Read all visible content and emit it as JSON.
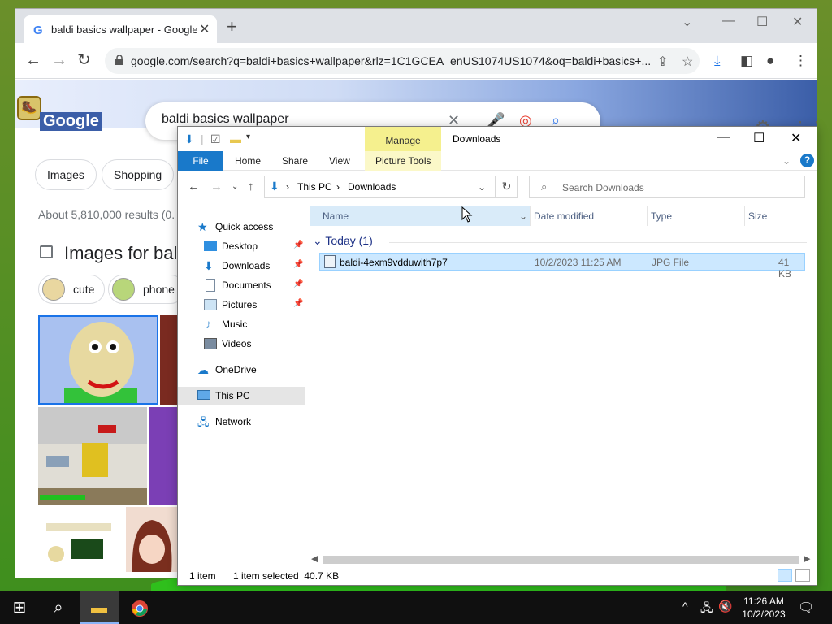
{
  "chrome": {
    "tab_title": "baldi basics wallpaper - Google Search",
    "tab_close": "✕",
    "new_tab": "+",
    "url": "google.com/search?q=baldi+basics+wallpaper&rlz=1C1GCEA_enUS1074US1074&oq=baldi+basics+..."
  },
  "google": {
    "logo": "Google",
    "search_query": "baldi basics wallpaper",
    "chips": [
      "Images",
      "Shopping"
    ],
    "results_count": "About 5,810,000 results (0.",
    "images_heading": "Images for bal",
    "image_chips": [
      "cute",
      "phone"
    ]
  },
  "explorer": {
    "title": "Downloads",
    "manage_label": "Manage",
    "picture_tools_label": "Picture Tools",
    "ribbon_tabs": {
      "file": "File",
      "home": "Home",
      "share": "Share",
      "view": "View"
    },
    "help": "?",
    "address": {
      "this_pc": "This PC",
      "downloads": "Downloads",
      "sep": "›"
    },
    "search_placeholder": "Search Downloads",
    "nav": {
      "quick_access": "Quick access",
      "desktop": "Desktop",
      "downloads": "Downloads",
      "documents": "Documents",
      "pictures": "Pictures",
      "music": "Music",
      "videos": "Videos",
      "onedrive": "OneDrive",
      "this_pc": "This PC",
      "network": "Network"
    },
    "columns": {
      "name": "Name",
      "date": "Date modified",
      "type": "Type",
      "size": "Size"
    },
    "group": "Today (1)",
    "file": {
      "name": "baldi-4exm9vdduwith7p7",
      "date": "10/2/2023 11:25 AM",
      "type": "JPG File",
      "size": "41 KB"
    },
    "status": {
      "items": "1 item",
      "selected": "1 item selected  40.7 KB"
    }
  },
  "taskbar": {
    "time": "11:26 AM",
    "date": "10/2/2023"
  },
  "colors": {
    "accent": "#1979ca",
    "selection": "#cce8ff",
    "manage": "#f5f08e"
  }
}
